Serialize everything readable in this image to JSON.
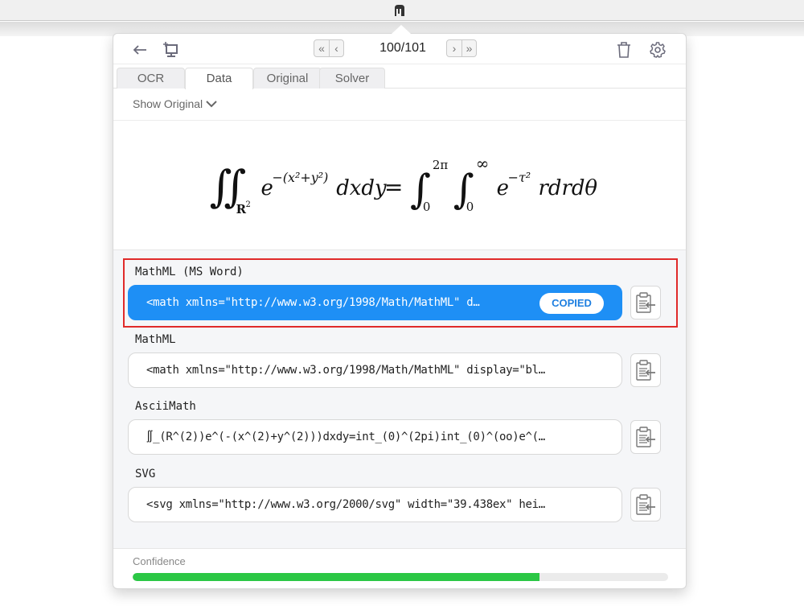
{
  "toolbar": {
    "page_counter": "100/101",
    "icons": [
      "back-arrow-icon",
      "new-snip-icon",
      "first-page-icon",
      "prev-page-icon",
      "next-page-icon",
      "last-page-icon",
      "trash-icon",
      "gear-icon"
    ]
  },
  "tabs": [
    {
      "label": "OCR",
      "active": false
    },
    {
      "label": "Data",
      "active": true
    },
    {
      "label": "Original",
      "active": false
    },
    {
      "label": "Solver",
      "active": false
    }
  ],
  "show_original": "Show Original",
  "formula_latex": "\\iint_{\\mathbf{R}^2} e^{-(x^2+y^2)} dxdy = \\int_0^{2\\pi}\\int_0^{\\infty} e^{-\\tau^2} rdrd\\theta",
  "formats": [
    {
      "label": "MathML (MS Word)",
      "value": "<math xmlns=\"http://www.w3.org/1998/Math/MathML\" d…",
      "copied": true,
      "badge": "COPIED"
    },
    {
      "label": "MathML",
      "value": "<math xmlns=\"http://www.w3.org/1998/Math/MathML\" display=\"bl…",
      "copied": false
    },
    {
      "label": "AsciiMath",
      "value": "∬_(R^(2))e^(-(x^(2)+y^(2)))dxdy=int_(0)^(2pi)int_(0)^(oo)e^(…",
      "copied": false
    },
    {
      "label": "SVG",
      "value": "<svg xmlns=\"http://www.w3.org/2000/svg\" width=\"39.438ex\" hei…",
      "copied": false
    }
  ],
  "confidence": {
    "label": "Confidence",
    "value_percent": 76,
    "color": "#2bc745"
  },
  "colors": {
    "accent": "#1e8ff5",
    "highlight_border": "#e02a2a"
  }
}
